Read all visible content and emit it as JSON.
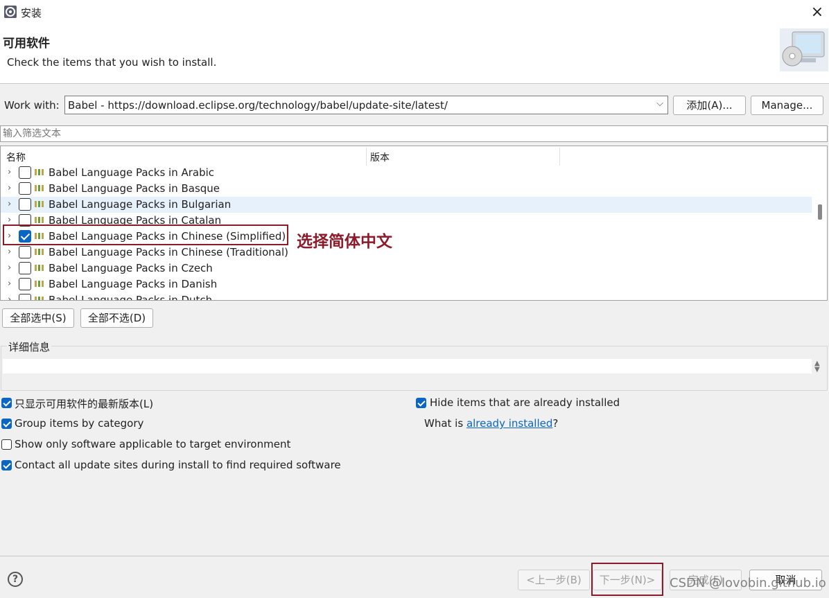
{
  "window": {
    "title": "安装"
  },
  "banner": {
    "title": "可用软件",
    "description": "Check the items that you wish to install."
  },
  "work_with": {
    "label": "Work with:",
    "value": "Babel - https://download.eclipse.org/technology/babel/update-site/latest/",
    "add_label": "添加(A)...",
    "manage_label": "Manage..."
  },
  "filter": {
    "placeholder": "输入筛选文本"
  },
  "table": {
    "columns": [
      "名称",
      "版本"
    ],
    "rows": [
      {
        "label": "Babel Language Packs in Arabic",
        "checked": false
      },
      {
        "label": "Babel Language Packs in Basque",
        "checked": false
      },
      {
        "label": "Babel Language Packs in Bulgarian",
        "checked": false
      },
      {
        "label": "Babel Language Packs in Catalan",
        "checked": false
      },
      {
        "label": "Babel Language Packs in Chinese (Simplified)",
        "checked": true
      },
      {
        "label": "Babel Language Packs in Chinese (Traditional)",
        "checked": false
      },
      {
        "label": "Babel Language Packs in Czech",
        "checked": false
      },
      {
        "label": "Babel Language Packs in Danish",
        "checked": false
      },
      {
        "label": "Babel Language Packs in Dutch",
        "checked": false
      }
    ]
  },
  "annotation": {
    "text": "选择简体中文"
  },
  "selection_buttons": {
    "select_all": "全部选中(S)",
    "deselect_all": "全部不选(D)"
  },
  "details": {
    "label": "详细信息"
  },
  "options": {
    "latest_versions": {
      "label": "只显示可用软件的最新版本(L)",
      "checked": true
    },
    "group_by_category": {
      "label": "Group items by category",
      "checked": true
    },
    "applicable_only": {
      "label": "Show only software applicable to target environment",
      "checked": false
    },
    "contact_sites": {
      "label": "Contact all update sites during install to find required software",
      "checked": true
    },
    "hide_installed": {
      "label": "Hide items that are already installed",
      "checked": true
    },
    "what_is_prefix": "What is ",
    "what_is_link": "already installed",
    "what_is_suffix": "?"
  },
  "footer": {
    "back": "<上一步(B)",
    "next": "下一步(N)>",
    "finish": "完成(F)",
    "cancel": "取消",
    "watermark": "CSDN @lovobin.github.io"
  },
  "colors": {
    "accent": "#0a66c2",
    "annotation": "#8b1a2b"
  }
}
